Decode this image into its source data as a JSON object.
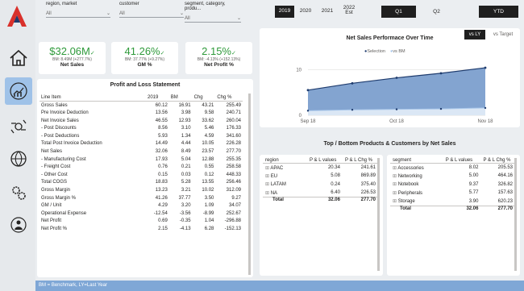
{
  "slicers": [
    {
      "label": "region, market",
      "value": "All"
    },
    {
      "label": "customer",
      "value": "All"
    },
    {
      "label": "segment, category, produ...",
      "value": "All"
    }
  ],
  "years": [
    "2019",
    "2020",
    "2021",
    "2022 Est"
  ],
  "selected_year": "2019",
  "quarters": [
    "Q1",
    "Q2",
    "YTD"
  ],
  "kpis": [
    {
      "value": "$32.06M",
      "sub": "BM: 8.49M (+277.7%)",
      "label": "Net Sales"
    },
    {
      "value": "41.26%",
      "sub": "BM: 37.77% (+9.27%)",
      "label": "GM %"
    },
    {
      "value": "2.15%",
      "sub": "BM: -4.13% (+152.13%)",
      "label": "Net Profit %"
    }
  ],
  "pl": {
    "title": "Profit and Loss Statement",
    "headers": [
      "Line Item",
      "2019",
      "BM",
      "Chg",
      "Chg %"
    ],
    "rows": [
      [
        "Gross Sales",
        "60.12",
        "16.91",
        "43.21",
        "255.49"
      ],
      [
        "Pre Invoice Deduction",
        "13.56",
        "3.98",
        "9.58",
        "240.71"
      ],
      [
        "Net Invoice Sales",
        "46.55",
        "12.93",
        "33.62",
        "260.04"
      ],
      [
        "- Post Discounts",
        "8.56",
        "3.10",
        "5.46",
        "176.33"
      ],
      [
        "- Post Deductions",
        "5.93",
        "1.34",
        "4.59",
        "341.60"
      ],
      [
        "Total Post Invoice Deduction",
        "14.49",
        "4.44",
        "10.05",
        "226.28"
      ],
      [
        "Net Sales",
        "32.06",
        "8.49",
        "23.57",
        "277.70"
      ],
      [
        "- Manufacturing Cost",
        "17.93",
        "5.04",
        "12.88",
        "255.35"
      ],
      [
        "- Freight Cost",
        "0.76",
        "0.21",
        "0.55",
        "258.58"
      ],
      [
        "- Other Cost",
        "0.15",
        "0.03",
        "0.12",
        "448.33"
      ],
      [
        "Total COGS",
        "18.83",
        "5.28",
        "13.55",
        "256.46"
      ],
      [
        "Gross Margin",
        "13.23",
        "3.21",
        "10.02",
        "312.09"
      ],
      [
        "Gross Margin %",
        "41.26",
        "37.77",
        "3.50",
        "9.27"
      ],
      [
        "GM / Unit",
        "4.29",
        "3.20",
        "1.09",
        "34.07"
      ],
      [
        "Operational Expense",
        "-12.54",
        "-3.56",
        "-8.99",
        "252.67"
      ],
      [
        "Net Profit",
        "0.69",
        "-0.35",
        "1.04",
        "-296.88"
      ],
      [
        "Net Profit %",
        "2.15",
        "-4.13",
        "6.28",
        "-152.13"
      ]
    ]
  },
  "line_chart": {
    "title": "Net Sales Performace Over Time",
    "toggle_selected": "vs LY",
    "toggle_other": "vs Target",
    "legend": [
      "Selection",
      "vs BM"
    ],
    "colors": {
      "selection": "#1f3c6e",
      "bm": "#a9c7ea",
      "area": "#6d94c8"
    }
  },
  "chart_data": {
    "type": "area",
    "title": "Net Sales Performace Over Time",
    "categories": [
      "Sep 18",
      "Oct 18",
      "Nov 18"
    ],
    "x_points": [
      "Sep 18",
      "",
      "Oct 18",
      "",
      "Nov 18"
    ],
    "series": [
      {
        "name": "Selection",
        "values": [
          5.5,
          7.0,
          8.2,
          9.2,
          10.4
        ]
      },
      {
        "name": "vs BM",
        "values": [
          1.0,
          1.2,
          1.3,
          1.4,
          1.6
        ]
      }
    ],
    "yticks": [
      "10",
      "0"
    ],
    "ylim": [
      0,
      12
    ]
  },
  "topbottom": {
    "title": "Top / Bottom Products & Customers by Net Sales",
    "region_headers": [
      "region",
      "P & L values",
      "P & L Chg %"
    ],
    "region_rows": [
      [
        "APAC",
        "20.34",
        "241.61"
      ],
      [
        "EU",
        "5.08",
        "869.89"
      ],
      [
        "LATAM",
        "0.24",
        "375.40"
      ],
      [
        "NA",
        "6.40",
        "226.53"
      ]
    ],
    "region_total": [
      "Total",
      "32.06",
      "277.70"
    ],
    "segment_headers": [
      "segment",
      "P & L values",
      "P & L Chg %"
    ],
    "segment_rows": [
      [
        "Accessories",
        "8.02",
        "205.53"
      ],
      [
        "Networking",
        "5.00",
        "464.16"
      ],
      [
        "Notebook",
        "9.37",
        "326.82"
      ],
      [
        "Peripherals",
        "5.77",
        "157.63"
      ],
      [
        "Storage",
        "3.90",
        "620.23"
      ]
    ],
    "segment_total": [
      "Total",
      "32.06",
      "277.70"
    ]
  },
  "footer": "BM = Benchmark, LY=Last Year",
  "nav_icons": [
    "home-icon",
    "finance-chart-icon",
    "money-exchange-icon",
    "globe-money-icon",
    "gears-icon",
    "people-network-icon"
  ]
}
